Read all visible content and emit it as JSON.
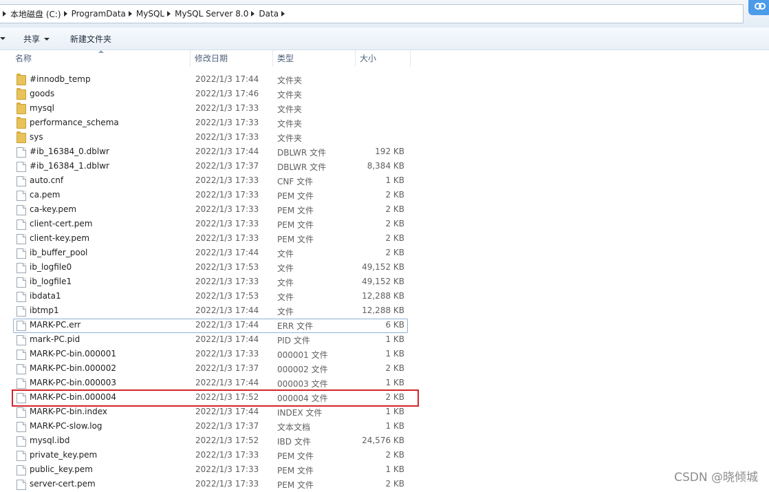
{
  "address": {
    "crumbs": [
      "本地磁盘 (C:)",
      "ProgramData",
      "MySQL",
      "MySQL Server 8.0",
      "Data"
    ]
  },
  "toolbar": {
    "share_label": "共享",
    "new_folder_label": "新建文件夹"
  },
  "columns": {
    "name": "名称",
    "date": "修改日期",
    "type": "类型",
    "size": "大小"
  },
  "files": [
    {
      "name": "#innodb_temp",
      "date": "2022/1/3 17:44",
      "type": "文件夹",
      "size": "",
      "kind": "folder"
    },
    {
      "name": "goods",
      "date": "2022/1/3 17:46",
      "type": "文件夹",
      "size": "",
      "kind": "folder"
    },
    {
      "name": "mysql",
      "date": "2022/1/3 17:33",
      "type": "文件夹",
      "size": "",
      "kind": "folder"
    },
    {
      "name": "performance_schema",
      "date": "2022/1/3 17:33",
      "type": "文件夹",
      "size": "",
      "kind": "folder"
    },
    {
      "name": "sys",
      "date": "2022/1/3 17:33",
      "type": "文件夹",
      "size": "",
      "kind": "folder"
    },
    {
      "name": "#ib_16384_0.dblwr",
      "date": "2022/1/3 17:44",
      "type": "DBLWR 文件",
      "size": "192 KB",
      "kind": "file"
    },
    {
      "name": "#ib_16384_1.dblwr",
      "date": "2022/1/3 17:37",
      "type": "DBLWR 文件",
      "size": "8,384 KB",
      "kind": "file"
    },
    {
      "name": "auto.cnf",
      "date": "2022/1/3 17:33",
      "type": "CNF 文件",
      "size": "1 KB",
      "kind": "file"
    },
    {
      "name": "ca.pem",
      "date": "2022/1/3 17:33",
      "type": "PEM 文件",
      "size": "2 KB",
      "kind": "file"
    },
    {
      "name": "ca-key.pem",
      "date": "2022/1/3 17:33",
      "type": "PEM 文件",
      "size": "2 KB",
      "kind": "file"
    },
    {
      "name": "client-cert.pem",
      "date": "2022/1/3 17:33",
      "type": "PEM 文件",
      "size": "2 KB",
      "kind": "file"
    },
    {
      "name": "client-key.pem",
      "date": "2022/1/3 17:33",
      "type": "PEM 文件",
      "size": "2 KB",
      "kind": "file"
    },
    {
      "name": "ib_buffer_pool",
      "date": "2022/1/3 17:44",
      "type": "文件",
      "size": "2 KB",
      "kind": "file"
    },
    {
      "name": "ib_logfile0",
      "date": "2022/1/3 17:53",
      "type": "文件",
      "size": "49,152 KB",
      "kind": "file"
    },
    {
      "name": "ib_logfile1",
      "date": "2022/1/3 17:33",
      "type": "文件",
      "size": "49,152 KB",
      "kind": "file"
    },
    {
      "name": "ibdata1",
      "date": "2022/1/3 17:53",
      "type": "文件",
      "size": "12,288 KB",
      "kind": "file"
    },
    {
      "name": "ibtmp1",
      "date": "2022/1/3 17:44",
      "type": "文件",
      "size": "12,288 KB",
      "kind": "file"
    },
    {
      "name": "MARK-PC.err",
      "date": "2022/1/3 17:44",
      "type": "ERR 文件",
      "size": "6 KB",
      "kind": "file"
    },
    {
      "name": "mark-PC.pid",
      "date": "2022/1/3 17:44",
      "type": "PID 文件",
      "size": "1 KB",
      "kind": "file"
    },
    {
      "name": "MARK-PC-bin.000001",
      "date": "2022/1/3 17:33",
      "type": "000001 文件",
      "size": "1 KB",
      "kind": "file"
    },
    {
      "name": "MARK-PC-bin.000002",
      "date": "2022/1/3 17:37",
      "type": "000002 文件",
      "size": "2 KB",
      "kind": "file"
    },
    {
      "name": "MARK-PC-bin.000003",
      "date": "2022/1/3 17:44",
      "type": "000003 文件",
      "size": "1 KB",
      "kind": "file"
    },
    {
      "name": "MARK-PC-bin.000004",
      "date": "2022/1/3 17:52",
      "type": "000004 文件",
      "size": "2 KB",
      "kind": "file"
    },
    {
      "name": "MARK-PC-bin.index",
      "date": "2022/1/3 17:44",
      "type": "INDEX 文件",
      "size": "1 KB",
      "kind": "file"
    },
    {
      "name": "MARK-PC-slow.log",
      "date": "2022/1/3 17:37",
      "type": "文本文档",
      "size": "1 KB",
      "kind": "file"
    },
    {
      "name": "mysql.ibd",
      "date": "2022/1/3 17:52",
      "type": "IBD 文件",
      "size": "24,576 KB",
      "kind": "file"
    },
    {
      "name": "private_key.pem",
      "date": "2022/1/3 17:33",
      "type": "PEM 文件",
      "size": "2 KB",
      "kind": "file"
    },
    {
      "name": "public_key.pem",
      "date": "2022/1/3 17:33",
      "type": "PEM 文件",
      "size": "1 KB",
      "kind": "file"
    },
    {
      "name": "server-cert.pem",
      "date": "2022/1/3 17:33",
      "type": "PEM 文件",
      "size": "2 KB",
      "kind": "file"
    }
  ],
  "watermark": "CSDN @晓倾城",
  "colors": {
    "highlight_box": "#d4242a",
    "focus_border": "#8fb0d6",
    "folder": "#e8c25a"
  }
}
